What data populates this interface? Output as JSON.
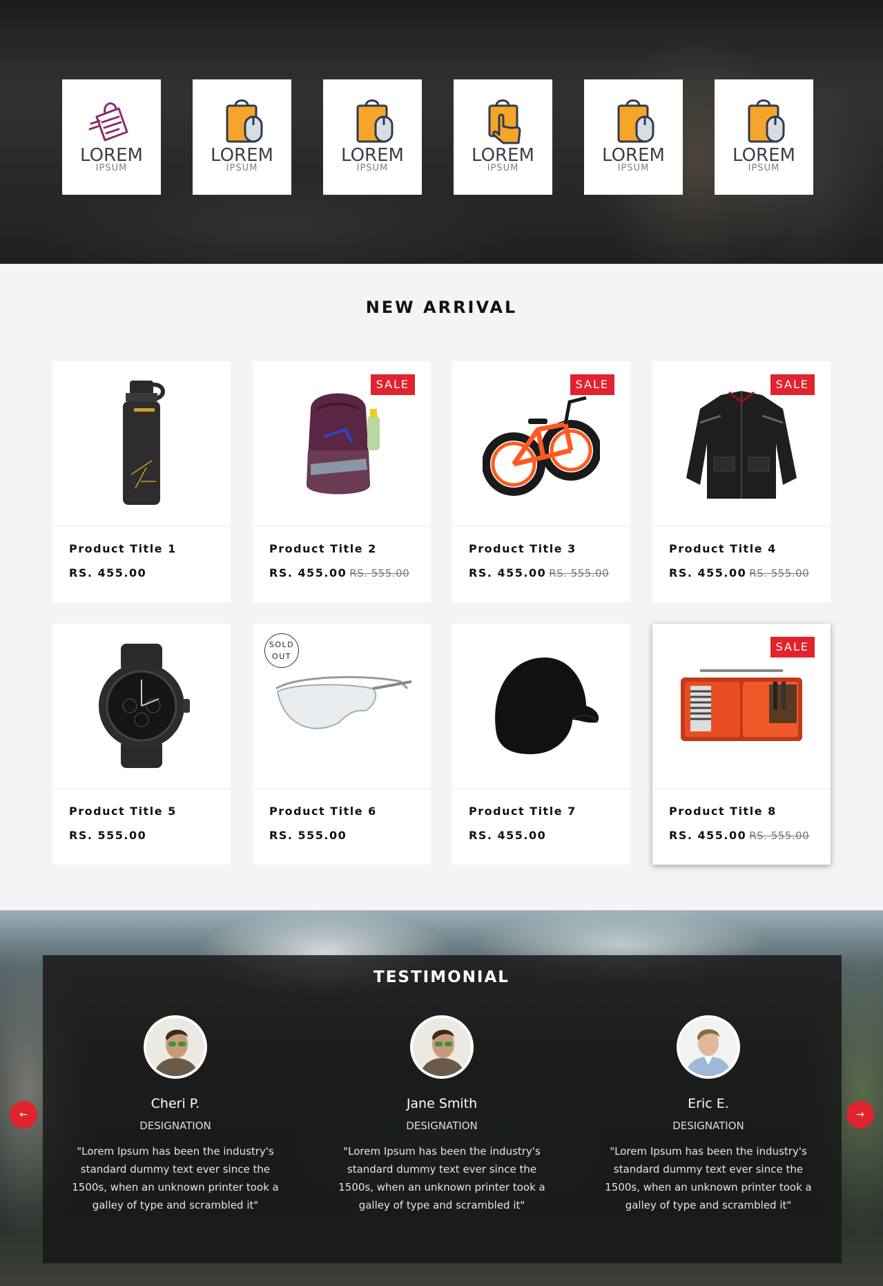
{
  "brands": [
    {
      "word": "LOREM",
      "sub": "IPSUM",
      "icon": "purple-clipboard-bag-icon"
    },
    {
      "word": "LOREM",
      "sub": "IPSUM",
      "icon": "shopping-bag-mouse-icon"
    },
    {
      "word": "LOREM",
      "sub": "IPSUM",
      "icon": "shopping-bag-mouse-icon"
    },
    {
      "word": "LOREM",
      "sub": "IPSUM",
      "icon": "shopping-bag-hand-icon"
    },
    {
      "word": "LOREM",
      "sub": "IPSUM",
      "icon": "shopping-bag-mouse-icon"
    },
    {
      "word": "LOREM",
      "sub": "IPSUM",
      "icon": "shopping-bag-mouse-icon"
    }
  ],
  "new_arrival": {
    "title": "NEW ARRIVAL",
    "products": [
      {
        "title": "Product Title 1",
        "price": "RS. 455.00",
        "old_price": "",
        "badge": "",
        "image": "water-bottle"
      },
      {
        "title": "Product Title 2",
        "price": "RS. 455.00",
        "old_price": "RS. 555.00",
        "badge": "SALE",
        "image": "backpack"
      },
      {
        "title": "Product Title 3",
        "price": "RS. 455.00",
        "old_price": "RS. 555.00",
        "badge": "SALE",
        "image": "fat-bike"
      },
      {
        "title": "Product Title 4",
        "price": "RS. 455.00",
        "old_price": "RS. 555.00",
        "badge": "SALE",
        "image": "jacket"
      },
      {
        "title": "Product Title 5",
        "price": "RS. 555.00",
        "old_price": "",
        "badge": "",
        "image": "watch"
      },
      {
        "title": "Product Title 6",
        "price": "RS. 555.00",
        "old_price": "",
        "badge": "SOLD OUT",
        "image": "safety-glasses"
      },
      {
        "title": "Product Title 7",
        "price": "RS. 455.00",
        "old_price": "",
        "badge": "",
        "image": "beanie-cap"
      },
      {
        "title": "Product Title 8",
        "price": "RS. 455.00",
        "old_price": "RS. 555.00",
        "badge": "SALE",
        "image": "wallet-organizer"
      }
    ],
    "sold_out_line1": "SOLD",
    "sold_out_line2": "OUT"
  },
  "testimonial": {
    "title": "TESTIMONIAL",
    "items": [
      {
        "name": "Cheri P.",
        "designation": "DESIGNATION",
        "quote": "\"Lorem Ipsum has been the industry's standard dummy text ever since the 1500s, when an unknown printer took a galley of type and scrambled it\""
      },
      {
        "name": "Jane Smith",
        "designation": "DESIGNATION",
        "quote": "\"Lorem Ipsum has been the industry's standard dummy text ever since the 1500s, when an unknown printer took a galley of type and scrambled it\""
      },
      {
        "name": "Eric E.",
        "designation": "DESIGNATION",
        "quote": "\"Lorem Ipsum has been the industry's standard dummy text ever since the 1500s, when an unknown printer took a galley of type and scrambled it\""
      }
    ],
    "prev_icon": "arrow-left-icon",
    "next_icon": "arrow-right-icon"
  },
  "colors": {
    "accent": "#e0232d",
    "brand_orange": "#f4a52a",
    "brand_navy": "#2f3a4c",
    "brand_purple": "#8a2a6f"
  }
}
